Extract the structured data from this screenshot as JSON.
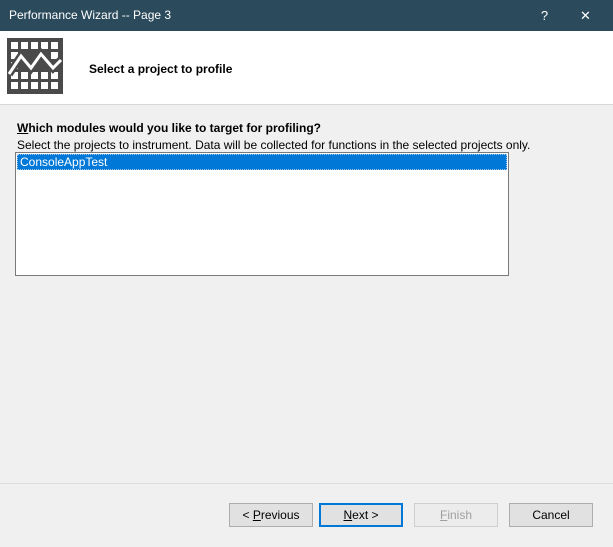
{
  "window": {
    "title": "Performance Wizard -- Page 3",
    "help_label": "?",
    "close_label": "✕"
  },
  "header": {
    "heading": "Select a project to profile",
    "logo_icon": "performance-chart-icon"
  },
  "content": {
    "question_first_letter": "W",
    "question_rest": "hich modules would you like to target for profiling?",
    "instruction": "Select the projects to instrument.  Data will be collected for functions in the selected projects only.",
    "projects": [
      "ConsoleAppTest"
    ],
    "selected_project": "ConsoleAppTest"
  },
  "buttons": {
    "previous_prefix": "< ",
    "previous_mnemonic": "P",
    "previous_rest": "revious",
    "next_mnemonic": "N",
    "next_rest": "ext >",
    "finish_mnemonic": "F",
    "finish_rest": "inish",
    "cancel": "Cancel"
  },
  "colors": {
    "titlebar": "#2b4b5c",
    "selection": "#0078d7",
    "dialog_bg": "#f0f0f0"
  }
}
